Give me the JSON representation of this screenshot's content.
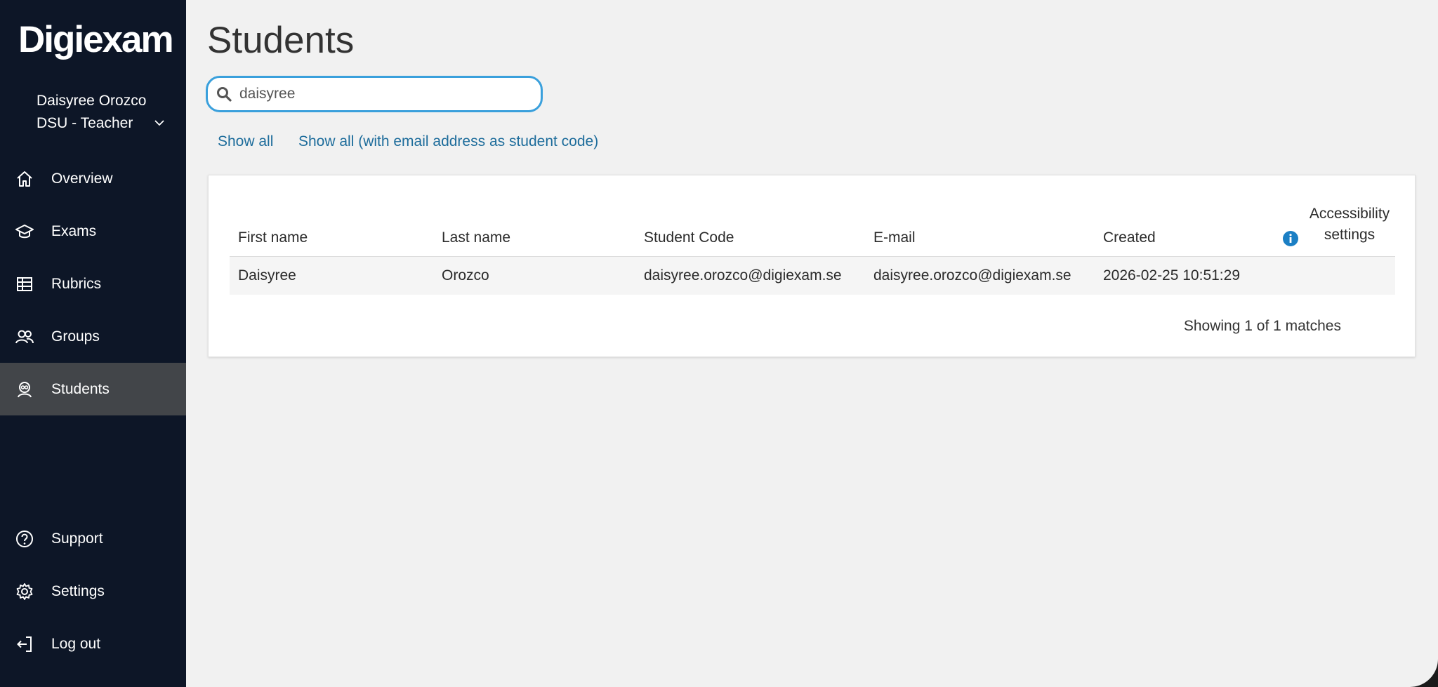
{
  "app": {
    "logo": "Digiexam"
  },
  "user": {
    "name": "Daisyree Orozco",
    "role": "DSU - Teacher"
  },
  "nav": {
    "main": [
      {
        "label": "Overview",
        "icon": "home-icon"
      },
      {
        "label": "Exams",
        "icon": "graduation-cap-icon"
      },
      {
        "label": "Rubrics",
        "icon": "table-grid-icon"
      },
      {
        "label": "Groups",
        "icon": "users-icon"
      },
      {
        "label": "Students",
        "icon": "student-icon",
        "active": true
      }
    ],
    "bottom": [
      {
        "label": "Support",
        "icon": "question-circle-icon"
      },
      {
        "label": "Settings",
        "icon": "gear-icon"
      },
      {
        "label": "Log out",
        "icon": "logout-icon"
      }
    ]
  },
  "page": {
    "title": "Students"
  },
  "search": {
    "value": "daisyree",
    "icon": "search-icon"
  },
  "links": {
    "show_all": "Show all",
    "show_all_email": "Show all (with email address as student code)"
  },
  "table": {
    "headers": {
      "first_name": "First name",
      "last_name": "Last name",
      "student_code": "Student Code",
      "email": "E-mail",
      "created": "Created",
      "accessibility_line1": "Accessibility",
      "accessibility_line2": "settings"
    },
    "rows": [
      {
        "first_name": "Daisyree",
        "last_name": "Orozco",
        "student_code": "daisyree.orozco@digiexam.se",
        "email": "daisyree.orozco@digiexam.se",
        "created": "2026-02-25 10:51:29"
      }
    ],
    "matches": "Showing 1 of 1 matches"
  },
  "colors": {
    "sidebar": "#0d1627",
    "active": "#424549",
    "link": "#1d6c9b",
    "focus": "#3aa0dc",
    "info": "#1b7fc4"
  }
}
